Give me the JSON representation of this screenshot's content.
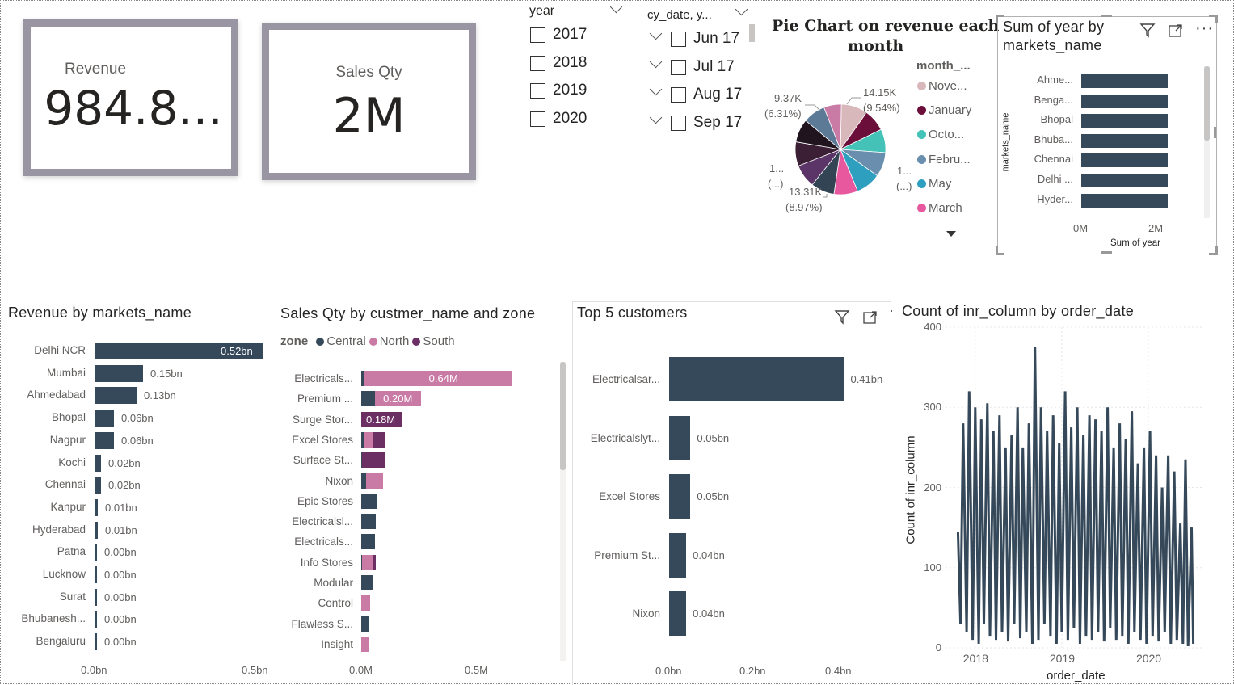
{
  "kpis": {
    "revenue": {
      "label": "Revenue",
      "value": "984.8..."
    },
    "sales_qty": {
      "label": "Sales Qty",
      "value": "2M"
    }
  },
  "year_slicer": {
    "title": "year",
    "options": [
      "2017",
      "2018",
      "2019",
      "2020"
    ]
  },
  "date_slicer": {
    "title": "cy_date, y...",
    "options": [
      "Jun 17",
      "Jul 17",
      "Aug 17",
      "Sep 17"
    ]
  },
  "pie": {
    "title_line1": "Pie Chart on revenue each",
    "title_line2": "month",
    "legend_title": "month_...",
    "legend": [
      {
        "name": "Nove...",
        "color": "#d9b8bb"
      },
      {
        "name": "January",
        "color": "#6b0f3a"
      },
      {
        "name": "Octo...",
        "color": "#44c2b8"
      },
      {
        "name": "Febru...",
        "color": "#6a8fae"
      },
      {
        "name": "May",
        "color": "#2f9fbf"
      },
      {
        "name": "March",
        "color": "#e8589f"
      }
    ],
    "labels": {
      "top_right_value": "14.15K",
      "top_right_pct": "(9.54%)",
      "top_left_value": "9.37K",
      "top_left_pct": "(6.31%)",
      "left_value": "1...",
      "left_pct": "(...)",
      "right_value": "1...",
      "right_pct": "(...)",
      "bottom_value": "13.31K",
      "bottom_pct": "(8.97%)"
    }
  },
  "sum_year": {
    "title_line1": "Sum of year by",
    "title_line2": "markets_name",
    "y_axis_title": "markets_name",
    "x_axis_title": "Sum of year",
    "ticks": [
      "0M",
      "2M"
    ]
  },
  "revenue_by_market": {
    "title": "Revenue by markets_name",
    "ticks": [
      "0.0bn",
      "0.5bn"
    ]
  },
  "sales_by_customer": {
    "title": "Sales Qty by custmer_name and zone",
    "legend_title": "zone",
    "legend": [
      {
        "name": "Central",
        "color": "#35495a"
      },
      {
        "name": "North",
        "color": "#c97ba6"
      },
      {
        "name": "South",
        "color": "#6b2f63"
      }
    ],
    "ticks": [
      "0.0M",
      "0.5M"
    ]
  },
  "top5": {
    "title": "Top 5 customers",
    "ticks": [
      "0.0bn",
      "0.2bn",
      "0.4bn"
    ]
  },
  "count_inr": {
    "title": "Count of inr_column by order_date",
    "y_axis_title": "Count of inr_column",
    "x_axis_title": "order_date",
    "y_ticks": [
      "0",
      "100",
      "200",
      "300",
      "400"
    ],
    "x_ticks": [
      "2018",
      "2019",
      "2020"
    ]
  },
  "chart_data": [
    {
      "type": "pie",
      "title": "Pie Chart on revenue each month",
      "legend_title": "month_...",
      "categories": [
        "Nove...",
        "January",
        "Octo...",
        "Febru...",
        "May",
        "March",
        "",
        "",
        "",
        "",
        "",
        ""
      ],
      "values": [
        9.54,
        8.0,
        8.5,
        8.8,
        8.97,
        8.6,
        8.5,
        8.4,
        8.7,
        8.4,
        8.1,
        6.31
      ],
      "colors": [
        "#d9b8bb",
        "#6b0f3a",
        "#44c2b8",
        "#6a8fae",
        "#2f9fbf",
        "#e8589f",
        "#334555",
        "#5b3567",
        "#3a1f35",
        "#20151e",
        "#5c7a95",
        "#c97ba6"
      ]
    },
    {
      "type": "bar",
      "title": "Sum of year by markets_name",
      "xlabel": "Sum of year",
      "ylabel": "markets_name",
      "categories": [
        "Ahme...",
        "Benga...",
        "Bhopal",
        "Bhuba...",
        "Chennai",
        "Delhi ...",
        "Hyder..."
      ],
      "values": [
        2.1,
        2.1,
        2.1,
        2.1,
        2.1,
        2.1,
        2.1
      ],
      "xlim": [
        0,
        2.5
      ]
    },
    {
      "type": "bar",
      "title": "Revenue by markets_name",
      "categories": [
        "Delhi NCR",
        "Mumbai",
        "Ahmedabad",
        "Bhopal",
        "Nagpur",
        "Kochi",
        "Chennai",
        "Kanpur",
        "Hyderabad",
        "Patna",
        "Lucknow",
        "Surat",
        "Bhubanesh...",
        "Bengaluru"
      ],
      "values": [
        0.52,
        0.15,
        0.13,
        0.06,
        0.06,
        0.02,
        0.02,
        0.01,
        0.01,
        0.0,
        0.0,
        0.0,
        0.0,
        0.0
      ],
      "labels": [
        "0.52bn",
        "0.15bn",
        "0.13bn",
        "0.06bn",
        "0.06bn",
        "0.02bn",
        "0.02bn",
        "0.01bn",
        "0.01bn",
        "0.00bn",
        "0.00bn",
        "0.00bn",
        "0.00bn",
        "0.00bn"
      ],
      "xlim": [
        0,
        0.5
      ]
    },
    {
      "type": "bar",
      "title": "Sales Qty by custmer_name and zone",
      "categories": [
        "Electricals...",
        "Premium ...",
        "Surge Stor...",
        "Excel Stores",
        "Surface St...",
        "Nixon",
        "Epic Stores",
        "Electricalsl...",
        "Electricals...",
        "Info Stores",
        "Modular",
        "Control",
        "Flawless S...",
        "Insight"
      ],
      "series": [
        {
          "name": "Central",
          "values": [
            0.015,
            0.06,
            0,
            0.01,
            0.003,
            0.02,
            0.065,
            0.062,
            0.06,
            0.005,
            0.053,
            0,
            0.03,
            0
          ]
        },
        {
          "name": "North",
          "values": [
            0.64,
            0.2,
            0,
            0.04,
            0,
            0.075,
            0,
            0,
            0,
            0.045,
            0,
            0.04,
            0,
            0.03
          ]
        },
        {
          "name": "South",
          "values": [
            0,
            0,
            0.18,
            0.05,
            0.1,
            0,
            0,
            0,
            0,
            0.012,
            0,
            0,
            0,
            0
          ]
        }
      ],
      "data_labels": {
        "Electricals...": "0.64M",
        "Premium ...": "0.20M",
        "Surge Stor...": "0.18M"
      },
      "xlim": [
        0,
        0.66
      ]
    },
    {
      "type": "bar",
      "title": "Top 5 customers",
      "categories": [
        "Electricalsar...",
        "Electricalslyt...",
        "Excel Stores",
        "Premium St...",
        "Nixon"
      ],
      "values": [
        0.41,
        0.05,
        0.05,
        0.04,
        0.04
      ],
      "labels": [
        "0.41bn",
        "0.05bn",
        "0.05bn",
        "0.04bn",
        "0.04bn"
      ],
      "xlim": [
        0,
        0.45
      ]
    },
    {
      "type": "line",
      "title": "Count of inr_column by order_date",
      "xlabel": "order_date",
      "ylabel": "Count of inr_column",
      "x_range": [
        "2017-10",
        "2020-06"
      ],
      "ylim": [
        0,
        400
      ],
      "series_color": "#35495a",
      "points": [
        [
          2017.8,
          145
        ],
        [
          2017.83,
          30
        ],
        [
          2017.86,
          280
        ],
        [
          2017.9,
          20
        ],
        [
          2017.93,
          320
        ],
        [
          2017.97,
          10
        ],
        [
          2018.0,
          300
        ],
        [
          2018.04,
          5
        ],
        [
          2018.07,
          285
        ],
        [
          2018.1,
          30
        ],
        [
          2018.14,
          305
        ],
        [
          2018.17,
          15
        ],
        [
          2018.21,
          270
        ],
        [
          2018.24,
          10
        ],
        [
          2018.28,
          290
        ],
        [
          2018.31,
          20
        ],
        [
          2018.35,
          250
        ],
        [
          2018.38,
          8
        ],
        [
          2018.42,
          265
        ],
        [
          2018.45,
          30
        ],
        [
          2018.49,
          300
        ],
        [
          2018.52,
          12
        ],
        [
          2018.55,
          250
        ],
        [
          2018.59,
          20
        ],
        [
          2018.62,
          280
        ],
        [
          2018.66,
          5
        ],
        [
          2018.69,
          375
        ],
        [
          2018.73,
          10
        ],
        [
          2018.76,
          300
        ],
        [
          2018.8,
          30
        ],
        [
          2018.83,
          270
        ],
        [
          2018.87,
          15
        ],
        [
          2018.9,
          290
        ],
        [
          2018.94,
          5
        ],
        [
          2018.97,
          255
        ],
        [
          2019.0,
          20
        ],
        [
          2019.04,
          320
        ],
        [
          2019.07,
          10
        ],
        [
          2019.11,
          275
        ],
        [
          2019.14,
          25
        ],
        [
          2019.18,
          300
        ],
        [
          2019.21,
          5
        ],
        [
          2019.25,
          265
        ],
        [
          2019.28,
          15
        ],
        [
          2019.32,
          290
        ],
        [
          2019.35,
          10
        ],
        [
          2019.39,
          285
        ],
        [
          2019.42,
          20
        ],
        [
          2019.46,
          270
        ],
        [
          2019.49,
          8
        ],
        [
          2019.53,
          300
        ],
        [
          2019.56,
          25
        ],
        [
          2019.6,
          250
        ],
        [
          2019.63,
          10
        ],
        [
          2019.67,
          280
        ],
        [
          2019.7,
          15
        ],
        [
          2019.74,
          260
        ],
        [
          2019.77,
          5
        ],
        [
          2019.81,
          295
        ],
        [
          2019.84,
          20
        ],
        [
          2019.88,
          230
        ],
        [
          2019.91,
          10
        ],
        [
          2019.95,
          250
        ],
        [
          2019.98,
          5
        ],
        [
          2020.02,
          270
        ],
        [
          2020.05,
          15
        ],
        [
          2020.09,
          240
        ],
        [
          2020.12,
          8
        ],
        [
          2020.16,
          200
        ],
        [
          2020.19,
          20
        ],
        [
          2020.23,
          240
        ],
        [
          2020.26,
          5
        ],
        [
          2020.3,
          220
        ],
        [
          2020.33,
          10
        ],
        [
          2020.37,
          155
        ],
        [
          2020.4,
          5
        ],
        [
          2020.43,
          235
        ],
        [
          2020.46,
          2
        ],
        [
          2020.5,
          150
        ],
        [
          2020.52,
          5
        ]
      ]
    }
  ]
}
